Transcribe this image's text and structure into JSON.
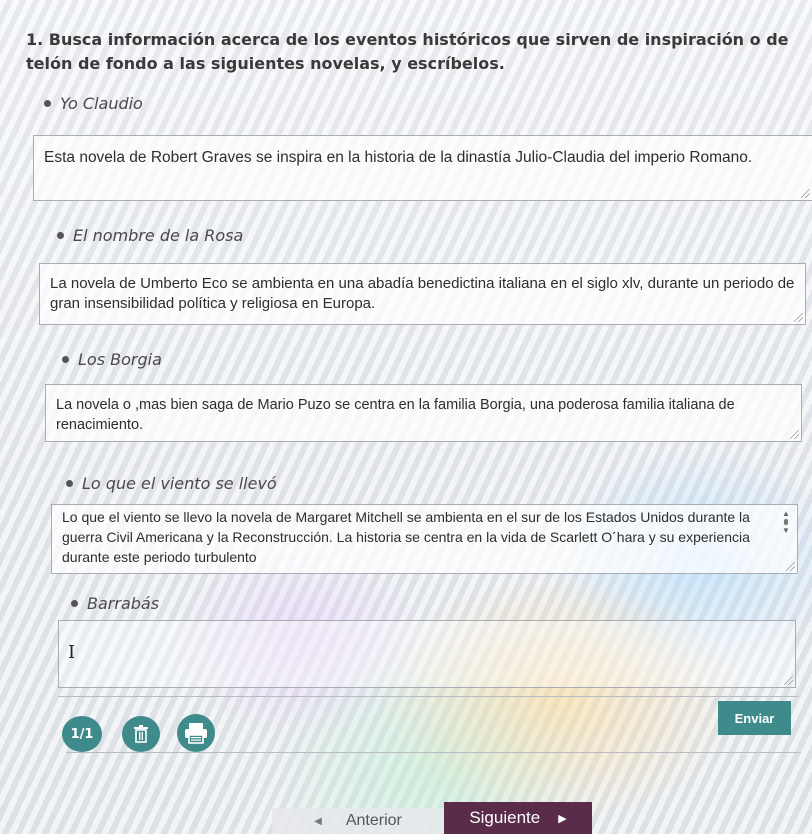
{
  "question": "1. Busca información acerca de los eventos históricos que sirven de inspiración o de telón de fondo a las siguientes novelas, y escríbelos.",
  "items": [
    {
      "title": "Yo Claudio",
      "answer": "Esta novela de Robert Graves se inspira en la historia de la dinastía Julio-Claudia del imperio Romano."
    },
    {
      "title": "El nombre de la Rosa",
      "answer": "La novela de Umberto Eco se ambienta en una abadía benedictina italiana en el siglo xlv, durante un periodo de gran insensibilidad política y religiosa en Europa."
    },
    {
      "title": "Los Borgia",
      "answer": "La novela o ,mas bien saga de Mario Puzo se centra en la familia Borgia, una poderosa familia italiana de renacimiento."
    },
    {
      "title": "Lo que el viento se llevó",
      "answer": "Lo que el viento se llevo la novela de Margaret Mitchell se ambienta en el sur de los Estados Unidos durante la guerra Civil Americana y la Reconstrucción. La historia se centra en la vida de Scarlett O´hara y su experiencia durante este periodo turbulento"
    },
    {
      "title": "Barrabás",
      "answer": ""
    }
  ],
  "cursor_glyph": "I",
  "footer": {
    "page_indicator": "1/1",
    "send_label": "Enviar"
  },
  "nav": {
    "prev_label": "Anterior",
    "next_label": "Siguiente"
  },
  "colors": {
    "teal": "#3f8b8b",
    "nav_dark": "#5b2b4a"
  }
}
